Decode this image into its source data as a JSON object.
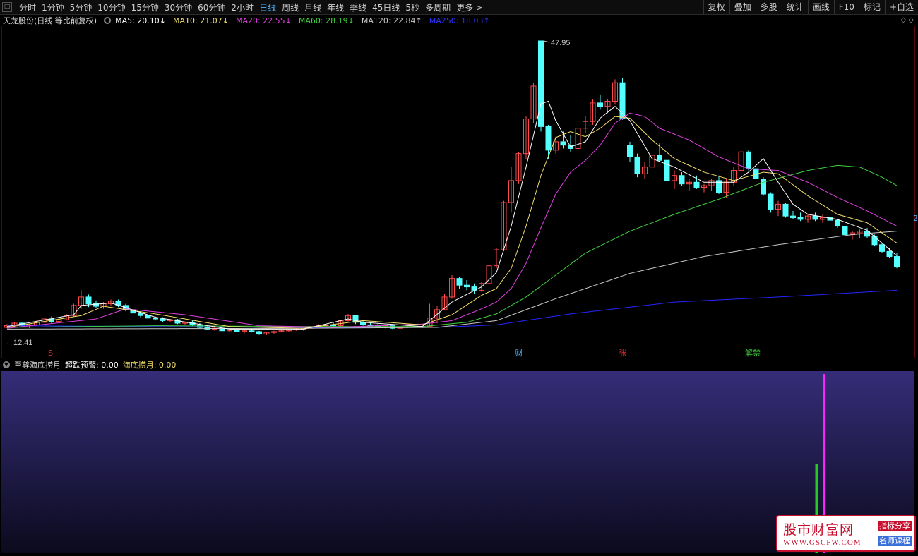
{
  "toolbar": {
    "periods": [
      "分时",
      "1分钟",
      "5分钟",
      "10分钟",
      "15分钟",
      "30分钟",
      "60分钟",
      "2小时",
      "日线",
      "周线",
      "月线",
      "年线",
      "季线",
      "45日线",
      "5秒",
      "多周期",
      "更多 >"
    ],
    "active_period": "日线",
    "right_buttons": [
      "复权",
      "叠加",
      "多股",
      "统计",
      "画线",
      "F10",
      "标记",
      "+自选"
    ]
  },
  "ma_bar": {
    "stock_title": "天龙股份(日线 等比前复权)",
    "items": [
      {
        "text": "MA5: 20.10↓",
        "color": "#ffffff"
      },
      {
        "text": "MA10: 21.07↓",
        "color": "#f4e06a"
      },
      {
        "text": "MA20: 22.55↓",
        "color": "#e040e0"
      },
      {
        "text": "MA60: 28.19↓",
        "color": "#40d040"
      },
      {
        "text": "MA120: 22.84↑",
        "color": "#c8c8c8"
      },
      {
        "text": "MA250: 18.03↑",
        "color": "#3030ff"
      }
    ]
  },
  "annotations": {
    "high_price": "47.95",
    "low_price": "12.41",
    "event_markers": [
      {
        "text": "S",
        "color": "#e03030"
      },
      {
        "text": "财",
        "color": "#4fb3ff"
      },
      {
        "text": "张",
        "color": "#e03030"
      },
      {
        "text": "解禁",
        "color": "#40d040"
      }
    ],
    "side_label": "2"
  },
  "indicator": {
    "name": "至尊海底捞月",
    "items": [
      {
        "text": "超跌预警: 0.00",
        "color": "#ffffff"
      },
      {
        "text": "海底捞月: 0.00",
        "color": "#f4e06a"
      }
    ]
  },
  "watermark": {
    "title": "股市财富网",
    "url": "WWW.GSCFW.COM",
    "tag1": "指标分享",
    "tag2": "名师课程"
  },
  "colors": {
    "up": "#ff4a4a",
    "down": "#54ffff",
    "ma5": "#ffffff",
    "ma10": "#f4e06a",
    "ma20": "#e040e0",
    "ma60": "#40d040",
    "ma120": "#c8c8c8",
    "ma250": "#2525ff"
  },
  "chart_data": {
    "type": "candlestick",
    "ylim": [
      12.41,
      47.95
    ],
    "candles": [
      [
        14.0,
        14.4,
        13.9,
        14.2
      ],
      [
        14.2,
        14.6,
        14.0,
        14.5
      ],
      [
        14.5,
        14.6,
        14.1,
        14.2
      ],
      [
        14.2,
        14.4,
        13.9,
        14.3
      ],
      [
        14.3,
        14.8,
        14.2,
        14.6
      ],
      [
        14.6,
        15.2,
        14.4,
        15.0
      ],
      [
        15.0,
        15.3,
        14.5,
        14.7
      ],
      [
        14.7,
        15.1,
        14.6,
        14.9
      ],
      [
        14.9,
        15.6,
        14.8,
        15.4
      ],
      [
        15.4,
        16.8,
        15.3,
        16.6
      ],
      [
        16.6,
        18.4,
        16.2,
        17.6
      ],
      [
        17.6,
        17.9,
        16.4,
        16.8
      ],
      [
        16.8,
        17.2,
        16.3,
        16.5
      ],
      [
        16.5,
        17.0,
        16.2,
        16.8
      ],
      [
        16.8,
        17.3,
        16.6,
        17.1
      ],
      [
        17.1,
        17.3,
        16.4,
        16.6
      ],
      [
        16.6,
        16.8,
        15.9,
        16.1
      ],
      [
        16.1,
        16.3,
        15.5,
        15.7
      ],
      [
        15.7,
        15.9,
        15.2,
        15.4
      ],
      [
        15.4,
        15.6,
        14.9,
        15.1
      ],
      [
        15.1,
        15.3,
        14.8,
        15.0
      ],
      [
        15.0,
        15.2,
        14.6,
        14.8
      ],
      [
        14.8,
        15.0,
        14.6,
        14.9
      ],
      [
        14.9,
        15.0,
        14.4,
        14.5
      ],
      [
        14.5,
        14.7,
        14.3,
        14.6
      ],
      [
        14.6,
        14.8,
        14.2,
        14.3
      ],
      [
        14.3,
        14.5,
        13.9,
        14.0
      ],
      [
        14.0,
        14.2,
        13.7,
        13.8
      ],
      [
        13.8,
        14.0,
        13.6,
        13.9
      ],
      [
        13.9,
        14.0,
        13.5,
        13.6
      ],
      [
        13.6,
        13.8,
        13.4,
        13.7
      ],
      [
        13.7,
        13.9,
        13.4,
        13.5
      ],
      [
        13.5,
        13.7,
        13.3,
        13.6
      ],
      [
        13.6,
        13.8,
        13.4,
        13.5
      ],
      [
        13.5,
        13.6,
        13.1,
        13.2
      ],
      [
        13.2,
        13.5,
        13.1,
        13.4
      ],
      [
        13.4,
        13.6,
        13.2,
        13.5
      ],
      [
        13.5,
        13.7,
        13.4,
        13.6
      ],
      [
        13.6,
        13.8,
        13.5,
        13.7
      ],
      [
        13.7,
        13.9,
        13.6,
        13.8
      ],
      [
        13.8,
        14.0,
        13.6,
        13.9
      ],
      [
        13.9,
        14.3,
        13.8,
        14.1
      ],
      [
        14.1,
        14.4,
        14.0,
        14.2
      ],
      [
        14.2,
        14.5,
        14.0,
        14.3
      ],
      [
        14.3,
        14.6,
        14.1,
        14.2
      ],
      [
        14.2,
        14.9,
        14.1,
        14.8
      ],
      [
        14.8,
        15.6,
        14.7,
        15.4
      ],
      [
        15.4,
        15.5,
        14.4,
        14.6
      ],
      [
        14.6,
        14.8,
        14.2,
        14.3
      ],
      [
        14.3,
        14.5,
        14.0,
        14.2
      ],
      [
        14.2,
        14.4,
        13.9,
        14.0
      ],
      [
        14.0,
        14.3,
        13.9,
        14.2
      ],
      [
        14.2,
        14.4,
        13.8,
        13.9
      ],
      [
        13.9,
        14.1,
        13.7,
        14.0
      ],
      [
        14.0,
        14.2,
        13.9,
        14.1
      ],
      [
        14.1,
        14.3,
        13.9,
        14.0
      ],
      [
        14.0,
        14.2,
        13.9,
        14.1
      ],
      [
        14.1,
        16.8,
        14.0,
        15.1
      ],
      [
        15.1,
        16.5,
        14.5,
        16.1
      ],
      [
        16.1,
        18.0,
        16.0,
        17.6
      ],
      [
        17.6,
        20.2,
        17.4,
        19.8
      ],
      [
        19.8,
        20.0,
        18.6,
        19.0
      ],
      [
        19.0,
        19.6,
        18.4,
        18.8
      ],
      [
        18.8,
        19.2,
        18.0,
        18.4
      ],
      [
        18.4,
        19.4,
        18.2,
        19.2
      ],
      [
        19.2,
        21.5,
        19.0,
        21.3
      ],
      [
        21.3,
        23.4,
        21.0,
        23.2
      ],
      [
        23.2,
        29.0,
        23.0,
        28.8
      ],
      [
        28.8,
        33.0,
        27.6,
        31.4
      ],
      [
        31.4,
        34.8,
        31.0,
        34.6
      ],
      [
        34.6,
        39.0,
        34.0,
        38.7
      ],
      [
        38.7,
        43.0,
        38.2,
        42.6
      ],
      [
        47.95,
        47.95,
        37.2,
        37.8
      ],
      [
        37.8,
        38.0,
        34.0,
        35.0
      ],
      [
        35.0,
        36.6,
        34.6,
        36.0
      ],
      [
        36.0,
        37.2,
        35.2,
        35.6
      ],
      [
        35.6,
        36.8,
        34.8,
        35.2
      ],
      [
        35.2,
        38.0,
        35.0,
        37.6
      ],
      [
        37.6,
        39.0,
        37.0,
        38.4
      ],
      [
        38.4,
        41.0,
        38.0,
        40.6
      ],
      [
        40.6,
        41.6,
        39.8,
        40.2
      ],
      [
        40.2,
        41.0,
        39.4,
        40.8
      ],
      [
        40.8,
        43.4,
        40.4,
        43.0
      ],
      [
        43.0,
        43.6,
        38.6,
        38.8
      ],
      [
        35.6,
        36.0,
        33.6,
        34.2
      ],
      [
        34.2,
        34.6,
        31.8,
        32.2
      ],
      [
        32.2,
        33.6,
        31.6,
        33.0
      ],
      [
        33.0,
        35.0,
        32.8,
        34.4
      ],
      [
        34.4,
        35.8,
        33.6,
        33.8
      ],
      [
        33.8,
        34.0,
        31.0,
        31.4
      ],
      [
        31.4,
        32.6,
        30.4,
        32.0
      ],
      [
        32.0,
        32.4,
        30.8,
        31.0
      ],
      [
        31.0,
        31.6,
        30.2,
        31.2
      ],
      [
        31.2,
        32.0,
        30.4,
        30.6
      ],
      [
        30.6,
        31.0,
        30.0,
        30.8
      ],
      [
        30.8,
        31.6,
        30.2,
        31.4
      ],
      [
        31.4,
        32.0,
        29.8,
        30.0
      ],
      [
        30.0,
        31.6,
        29.4,
        31.2
      ],
      [
        31.2,
        33.0,
        30.8,
        32.6
      ],
      [
        32.6,
        35.6,
        32.0,
        34.8
      ],
      [
        34.8,
        35.0,
        32.6,
        32.8
      ],
      [
        32.8,
        33.4,
        31.2,
        31.6
      ],
      [
        31.6,
        31.8,
        29.6,
        29.8
      ],
      [
        29.8,
        30.0,
        27.6,
        28.0
      ],
      [
        28.0,
        29.0,
        27.2,
        28.6
      ],
      [
        28.6,
        28.8,
        27.0,
        27.2
      ],
      [
        27.2,
        27.8,
        26.8,
        27.0
      ],
      [
        27.0,
        27.6,
        26.6,
        26.8
      ],
      [
        26.8,
        27.4,
        26.4,
        27.2
      ],
      [
        27.2,
        27.6,
        26.6,
        26.8
      ],
      [
        26.8,
        27.4,
        26.4,
        27.0
      ],
      [
        27.0,
        27.6,
        26.6,
        26.7
      ],
      [
        26.7,
        26.9,
        25.8,
        26.0
      ],
      [
        26.0,
        26.2,
        24.8,
        25.0
      ],
      [
        25.0,
        25.4,
        24.4,
        25.2
      ],
      [
        25.2,
        25.6,
        24.6,
        25.4
      ],
      [
        25.4,
        25.8,
        24.6,
        24.8
      ],
      [
        24.8,
        25.0,
        23.6,
        23.8
      ],
      [
        23.8,
        24.0,
        22.8,
        23.0
      ],
      [
        23.0,
        23.4,
        22.2,
        22.4
      ],
      [
        22.4,
        22.8,
        21.0,
        21.2
      ]
    ],
    "ma_anchors": {
      "ma5": [
        [
          0,
          14.1
        ],
        [
          9,
          15.5
        ],
        [
          10,
          16.6
        ],
        [
          14,
          16.9
        ],
        [
          20,
          15.2
        ],
        [
          30,
          13.8
        ],
        [
          40,
          13.8
        ],
        [
          46,
          15.0
        ],
        [
          48,
          14.6
        ],
        [
          56,
          14.1
        ],
        [
          60,
          17.0
        ],
        [
          64,
          18.8
        ],
        [
          66,
          20.5
        ],
        [
          68,
          26.0
        ],
        [
          70,
          33.0
        ],
        [
          72,
          40.5
        ],
        [
          73,
          40.8
        ],
        [
          74,
          38.5
        ],
        [
          76,
          35.4
        ],
        [
          78,
          36.0
        ],
        [
          80,
          38.8
        ],
        [
          82,
          40.2
        ],
        [
          84,
          38.5
        ],
        [
          87,
          34.0
        ],
        [
          90,
          33.0
        ],
        [
          94,
          31.2
        ],
        [
          98,
          31.2
        ],
        [
          100,
          32.4
        ],
        [
          102,
          34.0
        ],
        [
          104,
          31.2
        ],
        [
          106,
          28.6
        ],
        [
          108,
          27.4
        ],
        [
          112,
          26.8
        ],
        [
          116,
          25.5
        ],
        [
          120,
          22.5
        ]
      ],
      "ma10": [
        [
          0,
          14.0
        ],
        [
          10,
          15.4
        ],
        [
          13,
          16.5
        ],
        [
          20,
          15.6
        ],
        [
          30,
          14.1
        ],
        [
          40,
          13.9
        ],
        [
          48,
          14.8
        ],
        [
          56,
          14.3
        ],
        [
          60,
          15.5
        ],
        [
          64,
          17.8
        ],
        [
          66,
          18.6
        ],
        [
          68,
          21.0
        ],
        [
          70,
          26.0
        ],
        [
          72,
          32.0
        ],
        [
          74,
          36.5
        ],
        [
          76,
          37.2
        ],
        [
          78,
          36.6
        ],
        [
          80,
          37.6
        ],
        [
          82,
          39.0
        ],
        [
          84,
          38.8
        ],
        [
          87,
          36.2
        ],
        [
          90,
          34.0
        ],
        [
          94,
          32.4
        ],
        [
          98,
          31.4
        ],
        [
          102,
          32.4
        ],
        [
          104,
          32.2
        ],
        [
          108,
          29.6
        ],
        [
          112,
          27.4
        ],
        [
          116,
          26.4
        ],
        [
          120,
          24.0
        ]
      ],
      "ma20": [
        [
          0,
          13.9
        ],
        [
          12,
          15.0
        ],
        [
          16,
          16.2
        ],
        [
          24,
          15.5
        ],
        [
          34,
          14.2
        ],
        [
          44,
          14.0
        ],
        [
          56,
          14.4
        ],
        [
          60,
          14.8
        ],
        [
          64,
          16.2
        ],
        [
          66,
          17.0
        ],
        [
          68,
          18.6
        ],
        [
          70,
          21.6
        ],
        [
          72,
          25.8
        ],
        [
          74,
          29.8
        ],
        [
          76,
          32.4
        ],
        [
          78,
          33.8
        ],
        [
          80,
          35.6
        ],
        [
          82,
          38.2
        ],
        [
          84,
          39.4
        ],
        [
          86,
          39.0
        ],
        [
          88,
          37.6
        ],
        [
          92,
          36.2
        ],
        [
          96,
          34.2
        ],
        [
          100,
          32.8
        ],
        [
          104,
          32.6
        ],
        [
          108,
          31.2
        ],
        [
          112,
          29.4
        ],
        [
          116,
          27.8
        ],
        [
          120,
          26.0
        ]
      ],
      "ma60": [
        [
          0,
          14.0
        ],
        [
          20,
          14.2
        ],
        [
          40,
          14.1
        ],
        [
          56,
          14.1
        ],
        [
          62,
          14.6
        ],
        [
          66,
          15.6
        ],
        [
          70,
          17.6
        ],
        [
          74,
          20.2
        ],
        [
          78,
          22.8
        ],
        [
          84,
          25.4
        ],
        [
          90,
          27.4
        ],
        [
          96,
          29.2
        ],
        [
          102,
          31.2
        ],
        [
          108,
          32.6
        ],
        [
          112,
          33.2
        ],
        [
          115,
          33.0
        ],
        [
          118,
          31.8
        ],
        [
          120,
          30.8
        ]
      ],
      "ma120": [
        [
          0,
          13.8
        ],
        [
          40,
          13.9
        ],
        [
          58,
          14.0
        ],
        [
          66,
          14.8
        ],
        [
          74,
          17.4
        ],
        [
          84,
          20.4
        ],
        [
          94,
          22.4
        ],
        [
          104,
          23.8
        ],
        [
          114,
          25.0
        ],
        [
          120,
          25.4
        ]
      ],
      "ma250": [
        [
          0,
          14.2
        ],
        [
          40,
          14.0
        ],
        [
          58,
          14.0
        ],
        [
          66,
          14.3
        ],
        [
          76,
          15.6
        ],
        [
          90,
          17.0
        ],
        [
          104,
          17.6
        ],
        [
          120,
          18.4
        ]
      ]
    },
    "lower_bars": [
      {
        "index": 109,
        "value": 0.5,
        "color": "#22cc22"
      },
      {
        "index": 110,
        "value": 1.0,
        "color": "#ff22ff"
      }
    ]
  }
}
